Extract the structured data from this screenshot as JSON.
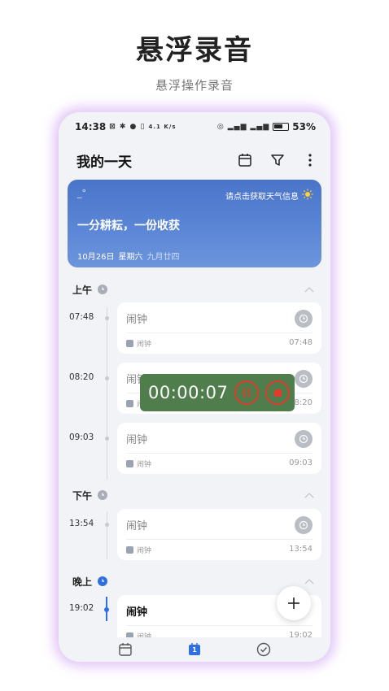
{
  "promo": {
    "title": "悬浮录音",
    "subtitle": "悬浮操作录音"
  },
  "status_bar": {
    "time": "14:38",
    "icons_left": [
      "mute-icon",
      "bluetooth-icon",
      "location-icon",
      "nfc-icon",
      "data-speed-icon"
    ],
    "speed_text": "4.1 K/s",
    "icons_right": [
      "hotspot-icon",
      "signal-5g-icon",
      "signal-5g-icon",
      "battery-icon"
    ],
    "battery": "53%"
  },
  "header": {
    "title": "我的一天",
    "icons": [
      "calendar-icon",
      "filter-icon",
      "more-icon"
    ]
  },
  "weather": {
    "temp": "_°",
    "hint": "请点击获取天气信息",
    "quote": "一分耕耘，一份收获",
    "date": "10月26日",
    "weekday": "星期六",
    "lunar": "九月廿四"
  },
  "sections": {
    "morning": "上午",
    "afternoon": "下午",
    "evening": "晚上"
  },
  "events": [
    {
      "time": "07:48",
      "title": "闹钟",
      "tag": "闹钟",
      "time_right": "07:48",
      "active": false
    },
    {
      "time": "08:20",
      "title": "闹钟",
      "tag": "闹钟",
      "time_right": "08:20",
      "active": false
    },
    {
      "time": "09:03",
      "title": "闹钟",
      "tag": "闹钟",
      "time_right": "09:03",
      "active": false
    },
    {
      "time": "13:54",
      "title": "闹钟",
      "tag": "闹钟",
      "time_right": "13:54",
      "active": false
    },
    {
      "time": "19:02",
      "title": "闹钟",
      "tag": "闹钟",
      "time_right": "19:02",
      "active": true
    }
  ],
  "recorder": {
    "elapsed": "00:00:07",
    "color": "#4f7e4c",
    "accent": "#e23b2c"
  },
  "bottom_nav": {
    "items": [
      "calendar-outline-icon",
      "calendar-today-icon",
      "check-circle-icon"
    ],
    "active_index": 1,
    "today_badge": "1"
  },
  "colors": {
    "accent": "#2f6fe0",
    "glow": "#cb96f0"
  }
}
